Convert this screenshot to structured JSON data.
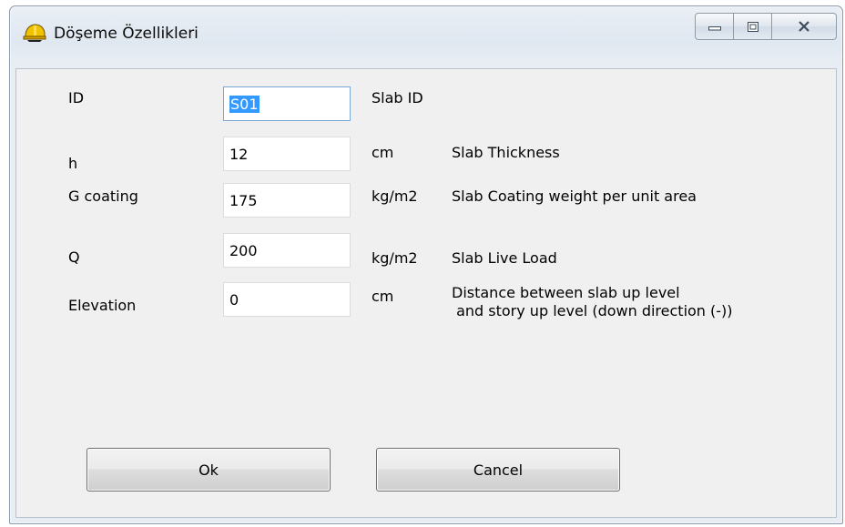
{
  "window": {
    "title": "Döşeme Özellikleri",
    "icon": "helmet-icon"
  },
  "caption_buttons": {
    "minimize_icon": "minimize-icon",
    "maximize_icon": "maximize-icon",
    "close_icon": "close-icon"
  },
  "rows": [
    {
      "label": "ID",
      "value": "S01",
      "unit": "",
      "description": "Slab ID"
    },
    {
      "label": "h",
      "value": "12",
      "unit": "cm",
      "description": "Slab Thickness"
    },
    {
      "label": "G coating",
      "value": "175",
      "unit": "kg/m2",
      "description": "Slab Coating weight per unit area"
    },
    {
      "label": "Q",
      "value": "200",
      "unit": "kg/m2",
      "description": "Slab Live Load"
    },
    {
      "label": "Elevation",
      "value": "0",
      "unit": "cm",
      "description_line1": "Distance between slab up level",
      "description_line2": " and story up level (down direction (-))"
    }
  ],
  "buttons": {
    "ok": "Ok",
    "cancel": "Cancel"
  },
  "colors": {
    "selection": "#3399ff",
    "dialog_bg": "#f0f0f0"
  }
}
